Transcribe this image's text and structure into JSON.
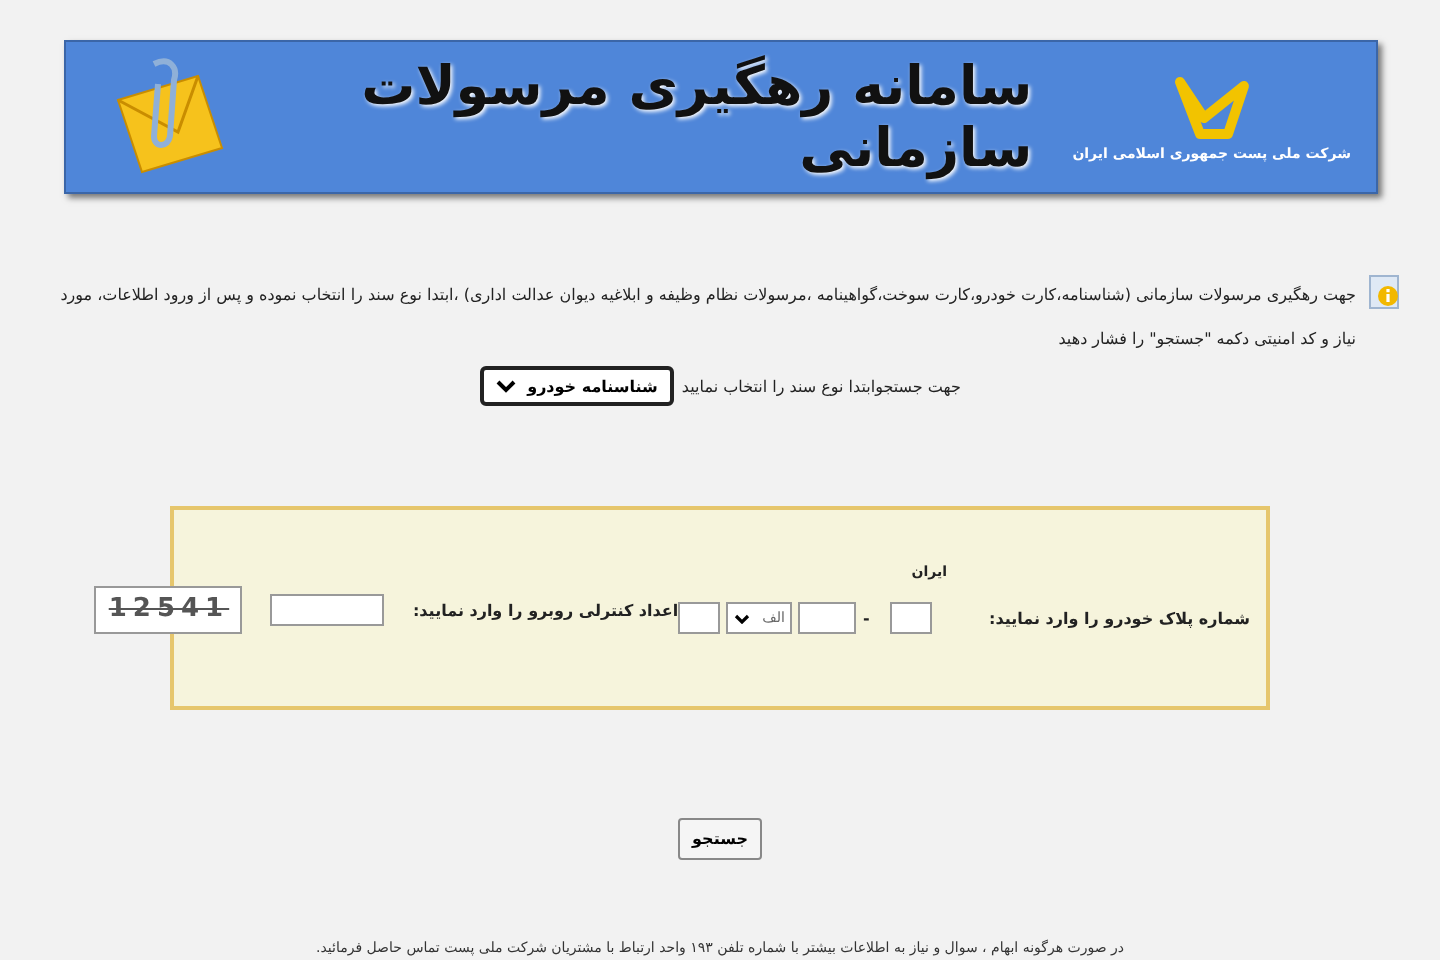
{
  "banner": {
    "title": "سامانه رهگیری مرسولات سازمانی",
    "company": "شرکت ملی پست جمهوری اسلامی ایران"
  },
  "intro": {
    "text": "جهت رهگیری مرسولات سازمانی (شناسنامه،کارت خودرو،کارت سوخت،گواهینامه ،مرسولات نظام وظیفه  و ابلاغیه دیوان عدالت اداری) ،ابتدا  نوع سند را انتخاب نموده و پس از ورود اطلاعات، مورد نیاز و کد امنیتی دکمه \"جستجو\" را فشار دهید"
  },
  "doc_type": {
    "label": "جهت جستجوابتدا نوع سند را انتخاب نمایید",
    "value": "شناسنامه خودرو"
  },
  "plate": {
    "label": "شماره پلاک خودرو را وارد نمایید:",
    "country": "ایران",
    "separator": "-",
    "letter": "الف"
  },
  "captcha": {
    "label": "اعداد کنترلی روبرو را وارد نمایید:",
    "code": "12541"
  },
  "search_button": "جستجو",
  "footer": "در صورت هرگونه ابهام ، سوال و نیاز به اطلاعات بیشتر با شماره تلفن ۱۹۳ واحد ارتباط  با مشتریان شرکت ملی پست تماس حاصل فرمائید."
}
